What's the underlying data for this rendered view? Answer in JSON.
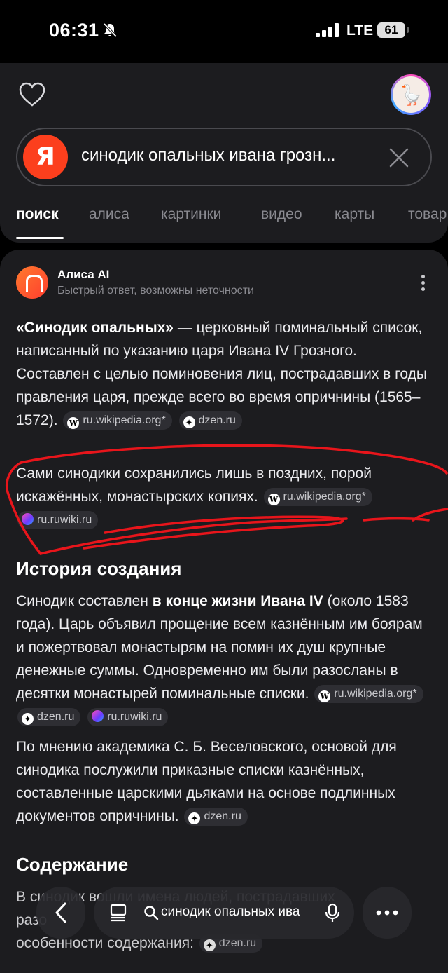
{
  "status": {
    "time": "06:31",
    "network": "LTE",
    "battery": "61"
  },
  "search": {
    "query": "синодик опальных ивана грозн...",
    "logo": "Я"
  },
  "tabs": [
    "поиск",
    "алиса",
    "картинки",
    "видео",
    "карты",
    "товар"
  ],
  "answer": {
    "source_name": "Алиса AI",
    "source_note": "Быстрый ответ, возможны неточности",
    "p1_bold": "«Синодик опальных»",
    "p1_text": " — церковный поминальный список, написанный по указанию царя Ивана IV Грозного. Составлен с целью поминовения лиц, пострадавших в годы правления царя, прежде всего во время опричнины (1565–1572).",
    "p2_text": "Сами синодики сохранились лишь в поздних, порой искажённых, монастырских копиях.",
    "h_history": "История создания",
    "p3_a": "Синодик составлен ",
    "p3_bold": "в конце жизни Ивана IV",
    "p3_b": " (около 1583 года). Царь объявил прощение всем казнённым им боярам и пожертвовал монастырям на помин их душ крупные денежные суммы. Одновременно им были разосланы в десятки монастырей поминальные списки.",
    "p4_text": "По мнению академика С. Б. Веселовского, основой для синодика послужили приказные списки казнённых, составленные царскими дьяками на основе подлинных документов опричнины.",
    "h_contents": "Содержание",
    "p5_partial": "В синодик вошли имена людей, пострадавших",
    "p5_line2": "разо",
    "p5_line3": "особенности содержания:"
  },
  "sources": {
    "wiki": "ru.wikipedia.org*",
    "dzen": "dzen.ru",
    "ruwiki": "ru.ruwiki.ru"
  },
  "bottom": {
    "query": "синодик опальных ива"
  },
  "colors": {
    "accent": "#fc3f1d",
    "annotation": "#e8151b",
    "background": "#1c1c1f"
  }
}
